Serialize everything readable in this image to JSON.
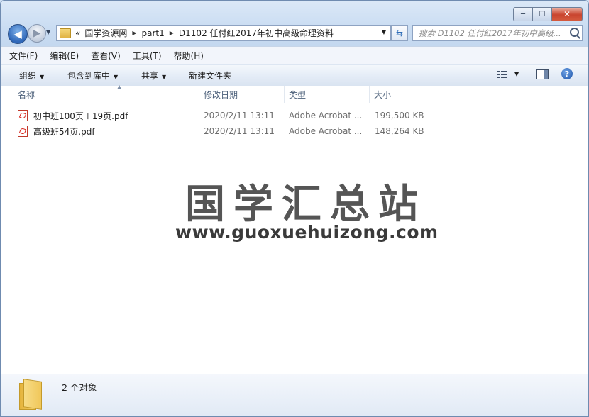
{
  "window": {
    "minimize": "─",
    "maximize": "☐",
    "close": "✕"
  },
  "nav": {
    "back_glyph": "◀",
    "forward_glyph": "▶",
    "breadcrumb_prefix": "«",
    "breadcrumbs": [
      "国学资源网",
      "part1",
      "D1102 任付红2017年初中高级命理资料"
    ],
    "search_placeholder": "搜索 D1102 任付红2017年初中高级..."
  },
  "menu": [
    "文件(F)",
    "编辑(E)",
    "查看(V)",
    "工具(T)",
    "帮助(H)"
  ],
  "commands": {
    "organize": "组织",
    "include": "包含到库中",
    "share": "共享",
    "new_folder": "新建文件夹"
  },
  "columns": {
    "name": "名称",
    "date": "修改日期",
    "type": "类型",
    "size": "大小"
  },
  "files": [
    {
      "name": "初中班100页＋19页.pdf",
      "date": "2020/2/11 13:11",
      "type": "Adobe Acrobat ...",
      "size": "199,500 KB"
    },
    {
      "name": "高级班54页.pdf",
      "date": "2020/2/11 13:11",
      "type": "Adobe Acrobat ...",
      "size": "148,264 KB"
    }
  ],
  "watermark": {
    "title": "国学汇总站",
    "url": "www.guoxuehuizong.com"
  },
  "status": {
    "count": "2 个对象"
  }
}
